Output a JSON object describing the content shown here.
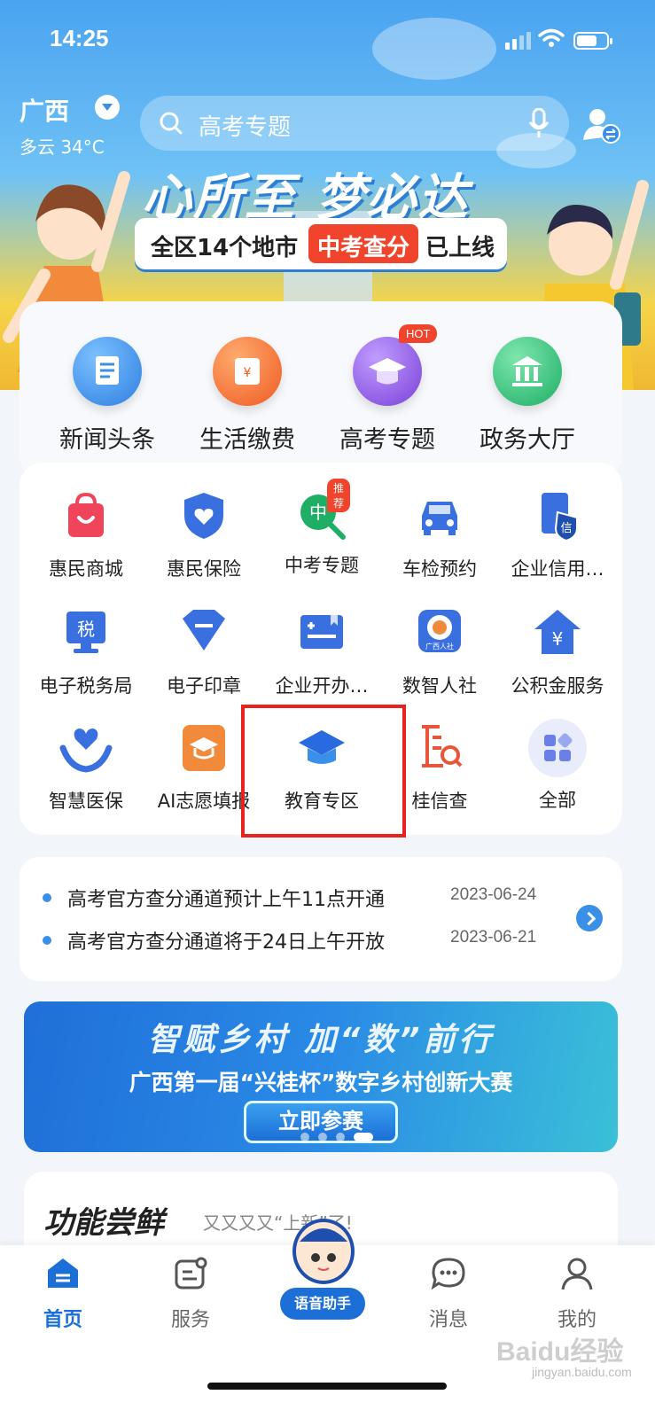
{
  "status": {
    "time": "14:25"
  },
  "header": {
    "region": "广西",
    "weather": "多云 34°C",
    "search_placeholder": "高考专题"
  },
  "banner": {
    "title": "心所至 梦必达",
    "pill_prefix": "全区14个地市",
    "pill_highlight": "中考查分",
    "pill_suffix": "已上线"
  },
  "quick": [
    {
      "label": "新闻头条",
      "icon": "news-icon",
      "color": "#3a8fe8"
    },
    {
      "label": "生活缴费",
      "icon": "payment-icon",
      "color": "#f26b2e"
    },
    {
      "label": "高考专题",
      "icon": "graduation-cap-icon",
      "color": "#8a52e0",
      "badge": "HOT"
    },
    {
      "label": "政务大厅",
      "icon": "government-hall-icon",
      "color": "#2ec27e"
    }
  ],
  "services": [
    {
      "label": "惠民商城",
      "icon": "shopping-bag-icon"
    },
    {
      "label": "惠民保险",
      "icon": "insurance-shield-icon"
    },
    {
      "label": "中考专题",
      "icon": "zhongkao-icon",
      "badge": "推荐",
      "glyph": "中"
    },
    {
      "label": "车检预约",
      "icon": "car-icon"
    },
    {
      "label": "企业信用…",
      "icon": "credit-doc-icon",
      "glyph": "信"
    },
    {
      "label": "电子税务局",
      "icon": "tax-monitor-icon",
      "glyph": "税"
    },
    {
      "label": "电子印章",
      "icon": "seal-icon"
    },
    {
      "label": "企业开办…",
      "icon": "business-start-icon"
    },
    {
      "label": "数智人社",
      "icon": "social-security-icon",
      "glyph": "广西人社"
    },
    {
      "label": "公积金服务",
      "icon": "housing-fund-icon",
      "glyph": "¥"
    },
    {
      "label": "智慧医保",
      "icon": "medical-insurance-icon"
    },
    {
      "label": "AI志愿填报",
      "icon": "ai-volunteer-icon"
    },
    {
      "label": "教育专区",
      "icon": "education-cap-icon"
    },
    {
      "label": "桂信查",
      "icon": "guixincha-icon"
    },
    {
      "label": "全部",
      "icon": "all-grid-icon"
    }
  ],
  "news": [
    {
      "title": "高考官方查分通道预计上午11点开通",
      "date": "2023-06-24"
    },
    {
      "title": "高考官方查分通道将于24日上午开放",
      "date": "2023-06-21"
    }
  ],
  "promo": {
    "title": "智赋乡村 加“数”前行",
    "subtitle": "广西第一届“兴桂杯”数字乡村创新大赛",
    "button": "立即参赛"
  },
  "feature": {
    "title": "功能尝鲜",
    "subtitle": "又又又又“上新”了!"
  },
  "tabs": [
    {
      "label": "首页",
      "icon": "home-icon",
      "active": true
    },
    {
      "label": "服务",
      "icon": "service-icon"
    },
    {
      "label": "消息",
      "icon": "message-icon"
    },
    {
      "label": "我的",
      "icon": "profile-icon"
    }
  ],
  "assistant": {
    "label": "语音助手"
  },
  "watermark": {
    "text": "Baidu经验",
    "sub": "jingyan.baidu.com"
  },
  "colors": {
    "accent": "#1c6fd6",
    "highlight_box": "#e8231e",
    "badge": "#f0442c"
  }
}
